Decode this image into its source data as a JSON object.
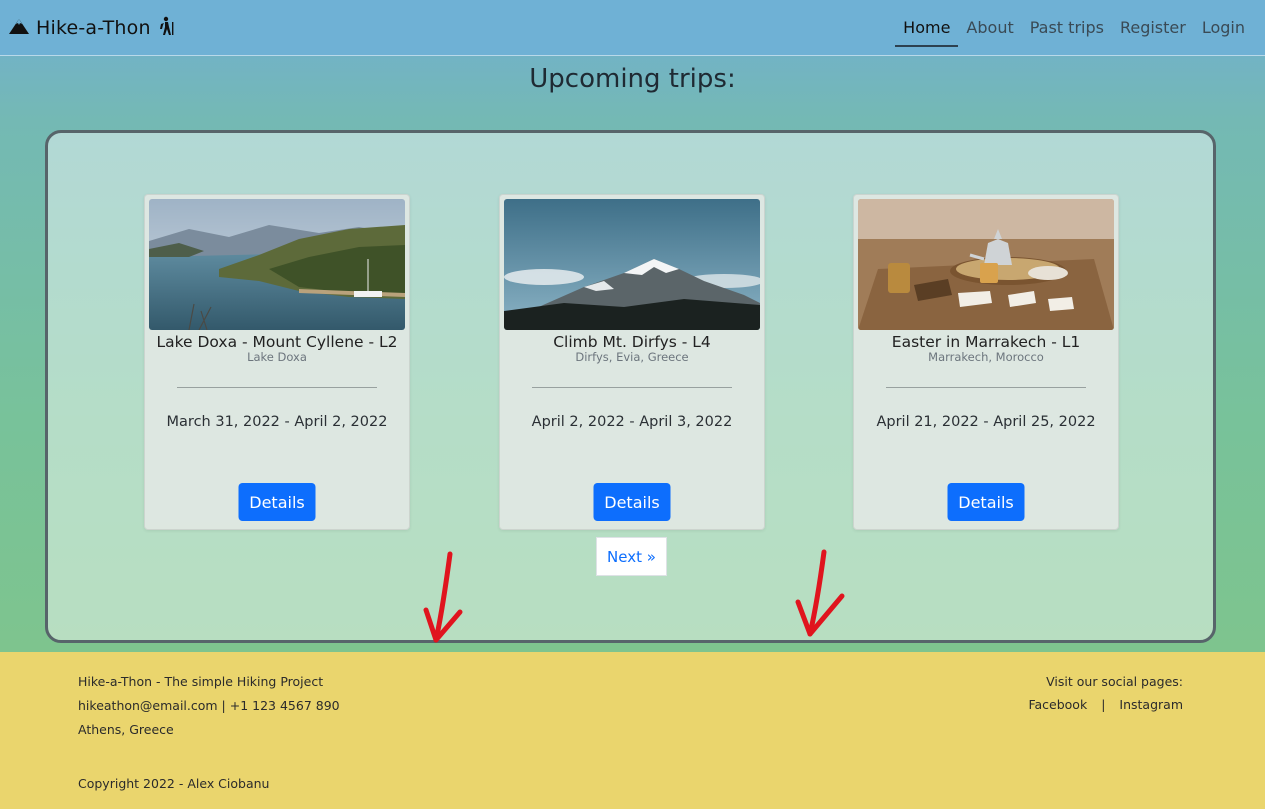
{
  "nav": {
    "brand": "Hike-a-Thon",
    "links": [
      {
        "label": "Home",
        "active": true
      },
      {
        "label": "About"
      },
      {
        "label": "Past trips"
      },
      {
        "label": "Register"
      },
      {
        "label": "Login"
      }
    ]
  },
  "main": {
    "title": "Upcoming trips:",
    "trips": [
      {
        "title": "Lake Doxa - Mount Cyllene - L2",
        "location": "Lake Doxa",
        "dates": "March 31, 2022 - April 2, 2022",
        "button": "Details"
      },
      {
        "title": "Climb Mt. Dirfys - L4",
        "location": "Dirfys, Evia, Greece",
        "dates": "April 2, 2022 - April 3, 2022",
        "button": "Details"
      },
      {
        "title": "Easter in Marrakech - L1",
        "location": "Marrakech, Morocco",
        "dates": "April 21, 2022 - April 25, 2022",
        "button": "Details"
      }
    ],
    "next_label": "Next »"
  },
  "footer": {
    "line1": "Hike-a-Thon - The simple Hiking Project",
    "line2": "hikeathon@email.com | +1 123 4567 890",
    "line3": "Athens, Greece",
    "copyright": "Copyright 2022 - Alex Ciobanu",
    "social_title": "Visit our social pages:",
    "facebook": "Facebook",
    "separator": "|",
    "instagram": "Instagram"
  },
  "colors": {
    "navbar": "#6fb1d5",
    "footer": "#ead56d",
    "primary_button": "#0d6efd",
    "annotation_arrow": "#e0141e"
  }
}
